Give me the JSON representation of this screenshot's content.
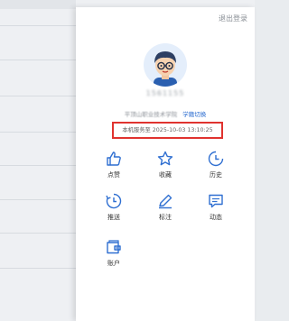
{
  "drawer": {
    "logout_label": "退出登录",
    "user_id": "1561155",
    "school": "平顶山职业技术学院",
    "switch_label": "学籍切换",
    "expire_text": "本机服务至 2025-10-03 13:10:25"
  },
  "menu": [
    {
      "label": "点赞",
      "icon": "thumbs-up-icon"
    },
    {
      "label": "收藏",
      "icon": "star-icon"
    },
    {
      "label": "历史",
      "icon": "clock-icon"
    },
    {
      "label": "推送",
      "icon": "push-clock-icon"
    },
    {
      "label": "标注",
      "icon": "pencil-icon"
    },
    {
      "label": "动态",
      "icon": "message-icon"
    },
    {
      "label": "账户",
      "icon": "wallet-icon"
    }
  ],
  "colors": {
    "accent": "#2f6fd1",
    "highlight_border": "#e0332f"
  }
}
